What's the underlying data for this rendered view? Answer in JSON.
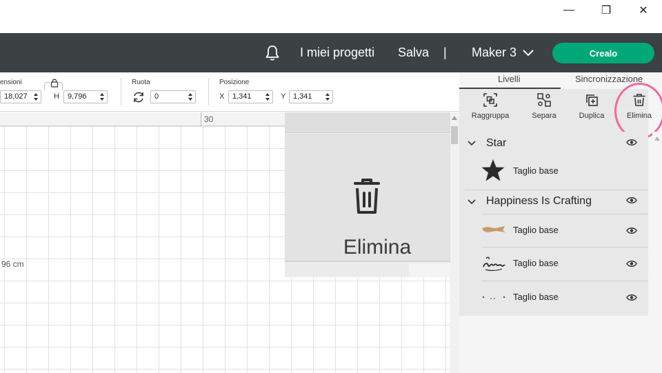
{
  "window": {
    "minimize": "—",
    "maximize": "❐",
    "close": "✕"
  },
  "header": {
    "projects": "I miei progetti",
    "save": "Salva",
    "separator": "|",
    "machine": "Maker 3",
    "make": "Crealo"
  },
  "toolbar": {
    "size_label": "ensioni",
    "width_value": "18,027",
    "height_prefix": "H",
    "height_value": "9,796",
    "rotate_label": "Ruota",
    "rotate_value": "0",
    "position_label": "Posizione",
    "x_prefix": "X",
    "x_value": "1,341",
    "y_prefix": "Y",
    "y_value": "1,341"
  },
  "canvas": {
    "ruler_mark": "30",
    "dimension_text": "96 cm"
  },
  "zoom": {
    "label": "Elimina"
  },
  "panel": {
    "tabs": [
      "Livelli",
      "Sincronizzazione"
    ],
    "actions": [
      "Raggruppa",
      "Separa",
      "Duplica",
      "Elimina"
    ],
    "groups": [
      {
        "name": "Star",
        "layers": [
          "Taglio base"
        ]
      },
      {
        "name": "Happiness Is Crafting",
        "layers": [
          "Taglio base",
          "Taglio base",
          "Taglio base"
        ]
      }
    ]
  },
  "colors": {
    "header": "#3c4143",
    "make_button": "#00a878",
    "highlight": "#f06aa0"
  }
}
